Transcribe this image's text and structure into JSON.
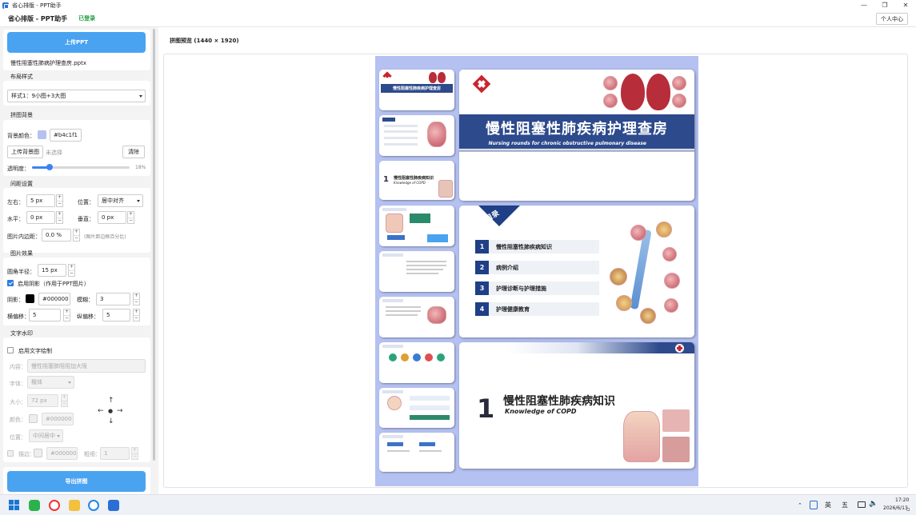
{
  "window": {
    "title": "省心排版 - PPT助手",
    "minimize": "—",
    "maximize": "❐",
    "close": "✕"
  },
  "header": {
    "brand": "省心排版 - PPT助手",
    "status": "已登录",
    "user_button": "个人中心"
  },
  "sidebar": {
    "upload_button": "上传PPT",
    "filename": "慢性阻塞性肺病护理查房.pptx",
    "layout": {
      "title": "布局样式",
      "value": "样式1：9小图+3大图"
    },
    "background": {
      "title": "拼图背景",
      "color_label": "背景颜色：",
      "color_hex": "#b4c1f1",
      "upload_button": "上传背景图",
      "none_selected": "未选择",
      "clear_button": "清除",
      "opacity_label": "透明度：",
      "opacity_value": "18%",
      "opacity_fraction": 0.18
    },
    "spacing": {
      "title": "间距设置",
      "lr_label": "左右：",
      "lr_value": "5 px",
      "position_label": "位置：",
      "position_value": "居中对齐",
      "h_label": "水平：",
      "h_value": "0 px",
      "v_label": "垂直：",
      "v_value": "0 px",
      "padding_label": "图片内边距：",
      "padding_value": "0.0 %",
      "padding_hint": "(图片距边框百分比)"
    },
    "effects": {
      "title": "图片效果",
      "radius_label": "圆角半径：",
      "radius_value": "15 px",
      "shadow_label": "启用阴影（作用于PPT图片）",
      "shadow_enabled": true,
      "shadow_color_label": "阴影：",
      "shadow_color_hex": "#000000",
      "blur_label": "模糊：",
      "blur_value": "3",
      "xoff_label": "横偏移：",
      "xoff_value": "5",
      "yoff_label": "纵偏移：",
      "yoff_value": "5"
    },
    "watermark": {
      "title": "文字水印",
      "enable_label": "启用文字绘制",
      "enabled": false,
      "content_label": "内容：",
      "content_value": "慢性阻塞肺阻阻加大阪",
      "font_label": "字体：",
      "font_value": "楷体",
      "size_label": "大小：",
      "size_value": "72 px",
      "color_label": "颜色：",
      "color_hex": "#000000",
      "pos_label": "位置：",
      "pos_value": "中间居中",
      "stroke_label": "描边：",
      "stroke_hex": "#000000",
      "thickness_label": "粗细：",
      "thickness_value": "1",
      "arrows": {
        "up": "↑",
        "down": "↓",
        "left": "←",
        "right": "→",
        "center": "●"
      }
    },
    "export_button": "导出拼图"
  },
  "main": {
    "preview_title": "拼图预览 (1440 × 1920)",
    "collage_bg": "#b4c1f1",
    "slides": {
      "cover_title": "慢性阻塞性肺疾病护理查房",
      "cover_subtitle": "Nursing rounds for chronic obstructive pulmonary disease",
      "toc_header": "目录",
      "toc_items": [
        {
          "num": "1",
          "label": "慢性阻塞性肺疾病知识"
        },
        {
          "num": "2",
          "label": "病例介绍"
        },
        {
          "num": "3",
          "label": "护理诊断与护理措施"
        },
        {
          "num": "4",
          "label": "护理健康教育"
        }
      ],
      "section_num": "1",
      "section_title": "慢性阻塞性肺疾病知识",
      "section_subtitle": "Knowledge of COPD",
      "thumb_cover_title": "慢性阻塞性肺疾病护理查房",
      "thumb_section_title": "慢性阻塞性肺疾病知识",
      "thumb_section_sub": "Knowledge of COPD"
    }
  },
  "taskbar": {
    "ime": "英",
    "ime2": "五",
    "time": "17:20",
    "date": "2026/6/13"
  },
  "colors": {
    "accent": "#4aa3f0",
    "navy": "#2d4a8c",
    "red": "#c8252f",
    "green": "#1c9c3d"
  }
}
